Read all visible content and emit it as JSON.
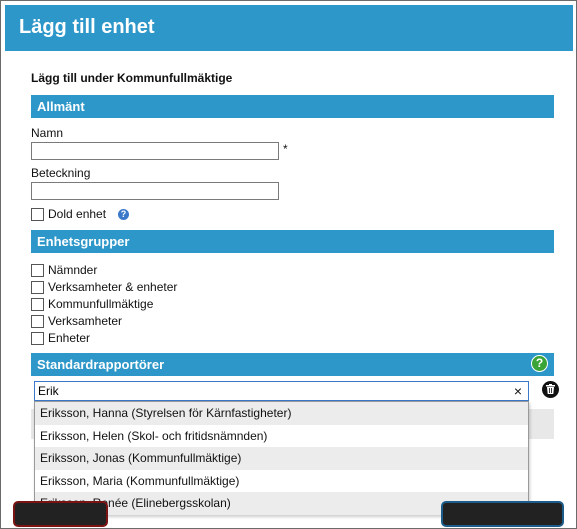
{
  "dialog": {
    "title": "Lägg till enhet",
    "context": "Lägg till under Kommunfullmäktige"
  },
  "general": {
    "heading": "Allmänt",
    "name_label": "Namn",
    "name_value": "",
    "required_mark": "*",
    "designation_label": "Beteckning",
    "designation_value": "",
    "hidden_label": "Dold enhet",
    "help_icon": "question-icon"
  },
  "groups": {
    "heading": "Enhetsgrupper",
    "items": [
      {
        "label": "Nämnder",
        "checked": false
      },
      {
        "label": "Verksamheter & enheter",
        "checked": false
      },
      {
        "label": "Kommunfullmäktige",
        "checked": false
      },
      {
        "label": "Verksamheter",
        "checked": false
      },
      {
        "label": "Enheter",
        "checked": false
      }
    ]
  },
  "reporters": {
    "heading": "Standardrapportörer",
    "help_icon": "question-icon",
    "search_value": "Erik",
    "clear_symbol": "×",
    "delete_icon": "trash-icon",
    "suggestions": [
      "Eriksson, Hanna (Styrelsen för Kärnfastigheter)",
      "Eriksson, Helen (Skol- och fritidsnämnden)",
      "Eriksson, Jonas (Kommunfullmäktige)",
      "Eriksson, Maria (Kommunfullmäktige)",
      "Eriksson, Renée (Elinebergsskolan)"
    ]
  },
  "colors": {
    "accent": "#2e97c9",
    "help_green": "#3aa436"
  }
}
